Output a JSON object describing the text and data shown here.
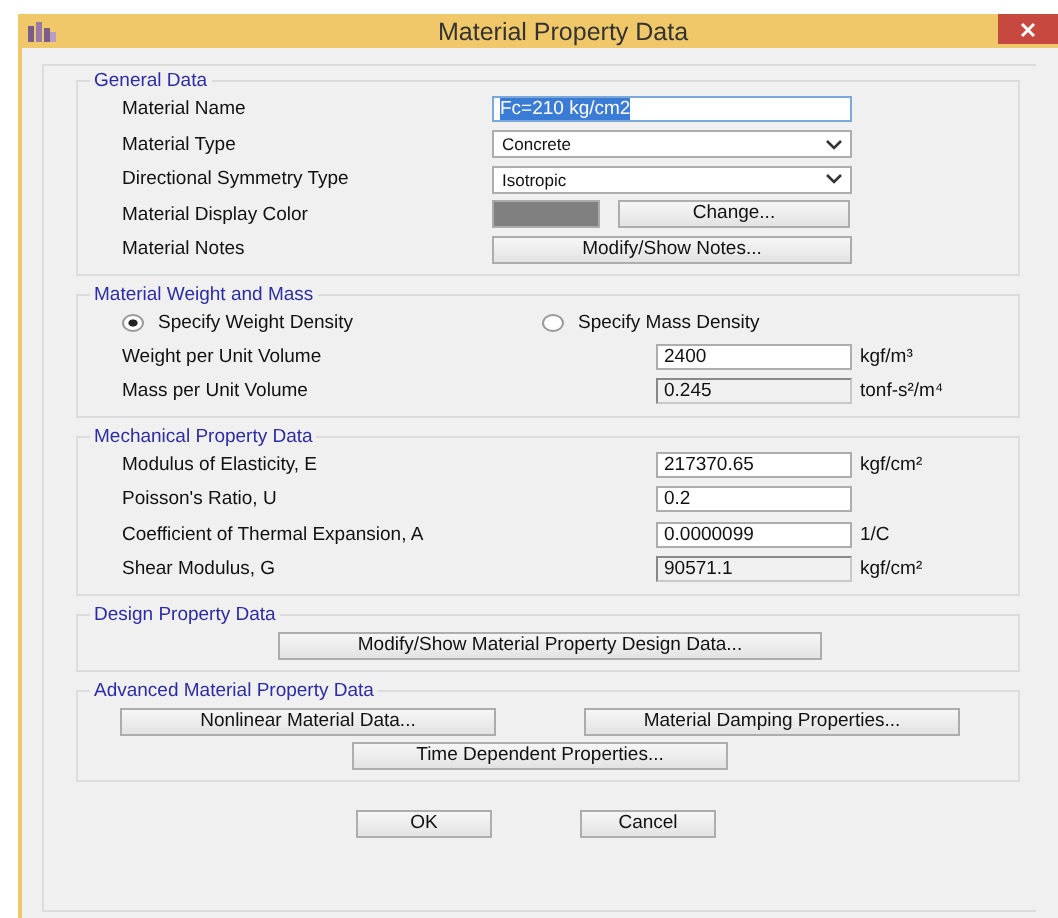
{
  "window": {
    "title": "Material Property Data"
  },
  "general": {
    "title": "General Data",
    "rows": [
      {
        "kind": "text",
        "label": "Material Name",
        "value": "Fc=210 kg/cm2",
        "selected": true
      },
      {
        "kind": "dropdown",
        "label": "Material Type",
        "value": "Concrete"
      },
      {
        "kind": "dropdown",
        "label": "Directional Symmetry Type",
        "value": "Isotropic"
      },
      {
        "kind": "color",
        "label": "Material Display Color",
        "color": "#808080",
        "button": "Change..."
      },
      {
        "kind": "button",
        "label": "Material Notes",
        "button": "Modify/Show Notes..."
      }
    ]
  },
  "weight": {
    "title": "Material Weight and Mass",
    "options": [
      {
        "label": "Specify Weight Density",
        "selected": true
      },
      {
        "label": "Specify Mass Density",
        "selected": false
      }
    ],
    "fields": [
      {
        "label": "Weight per Unit Volume",
        "value": "2400",
        "unit": "kgf/m³",
        "disabled": false
      },
      {
        "label": "Mass per Unit Volume",
        "value": "0.245",
        "unit": "tonf-s²/m⁴",
        "disabled": true
      }
    ]
  },
  "mechanical": {
    "title": "Mechanical Property Data",
    "fields": [
      {
        "label": "Modulus of Elasticity,  E",
        "value": "217370.65",
        "unit": "kgf/cm²",
        "disabled": false
      },
      {
        "label": "Poisson's Ratio,  U",
        "value": "0.2",
        "disabled": false
      },
      {
        "label": "Coefficient of Thermal Expansion,  A",
        "value": "0.0000099",
        "unit": "1/C",
        "disabled": false
      },
      {
        "label": "Shear Modulus,  G",
        "value": "90571.1",
        "unit": "kgf/cm²",
        "disabled": true
      }
    ]
  },
  "design": {
    "title": "Design Property Data",
    "buttons": [
      "Modify/Show Material Property Design Data..."
    ]
  },
  "advanced": {
    "title": "Advanced Material Property Data",
    "buttons": [
      "Nonlinear Material Data...",
      "Material Damping Properties...",
      "Time Dependent Properties..."
    ]
  },
  "buttons": [
    "OK",
    "Cancel"
  ]
}
